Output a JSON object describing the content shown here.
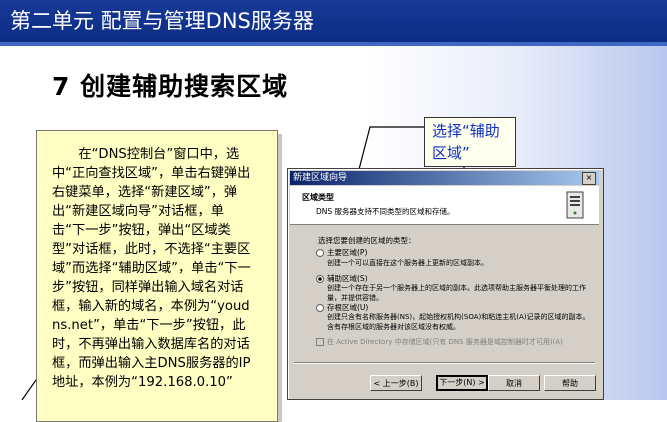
{
  "slide": {
    "title": "第二单元  配置与管理DNS服务器",
    "heading": "7 创建辅助搜索区域"
  },
  "note": {
    "text": "在“DNS控制台”窗口中，选中“正向查找区域”，单击右键弹出右键菜单，选择“新建区域”，弹出“新建区域向导”对话框，单击“下一步”按钮，弹出“区域类型”对话框，此时，不选择“主要区域”而选择“辅助区域”，单击“下一步”按钮，同样弹出输入域名对话框，输入新的域名，本例为“youdns.net”，单击“下一步”按钮，此时，不再弹出输入数据库名的对话框，而弹出输入主DNS服务器的IP地址，本例为“192.168.0.10”"
  },
  "callout": {
    "text": "选择“辅助区域”"
  },
  "dialog": {
    "title": "新建区域向导",
    "close": "×",
    "header_title": "区域类型",
    "header_sub": "DNS 服务器支持不同类型的区域和存储。",
    "question": "选择您要创建的区域的类型：",
    "options": [
      {
        "label": "主要区域(P)",
        "desc": "创建一个可以直接在这个服务器上更新的区域副本。",
        "selected": false
      },
      {
        "label": "辅助区域(S)",
        "desc": "创建一个存在于另一个服务器上的区域的副本。此选项帮助主服务器平衡处理的工作量，并提供容错。",
        "selected": true
      },
      {
        "label": "存根区域(U)",
        "desc": "创建只含有名称服务器(NS)，起始授权机构(SOA)和粘连主机(A)记录的区域的副本。含有存根区域的服务器对该区域没有权威。",
        "selected": false
      }
    ],
    "checkbox": "在 Active Directory 中存储区域(只有 DNS 服务器是域控制器时才可用)(A)",
    "buttons": {
      "back": "< 上一步(B)",
      "next": "下一步(N) >",
      "cancel": "取消",
      "help": "帮助"
    }
  },
  "colors": {
    "title_bar": "#173a97",
    "note_bg": "#ffffc4",
    "callout_text": "#1030c0",
    "dialog_bg": "#d4d0c8"
  }
}
